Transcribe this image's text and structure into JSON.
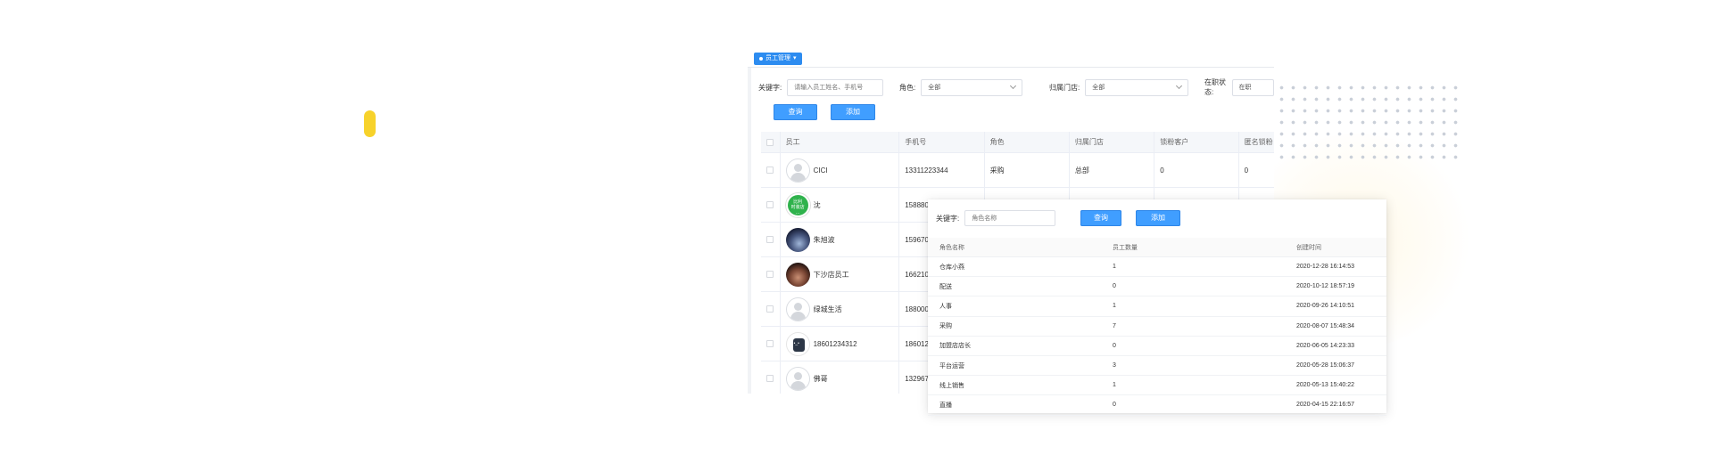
{
  "tabs": [
    {
      "label": "员工管理",
      "caret": "▾",
      "active": true
    }
  ],
  "filters": {
    "keyword_label": "关键字:",
    "keyword_placeholder": "请输入员工姓名、手机号",
    "role_label": "角色:",
    "role_value": "全部",
    "store_label": "归属门店:",
    "store_value": "全部",
    "status_label": "在职状态:",
    "status_value": "在职"
  },
  "buttons": {
    "search": "查询",
    "add": "添加"
  },
  "employee_table": {
    "columns": [
      "员工",
      "手机号",
      "角色",
      "归属门店",
      "锁粉客户",
      "匿名锁粉"
    ],
    "rows": [
      {
        "name": "CICI",
        "phone": "13311223344",
        "role": "采购",
        "store": "总部",
        "clients": "0",
        "anon": "0",
        "avatar": "default"
      },
      {
        "name": "沈",
        "phone": "1588803",
        "role": "",
        "store": "",
        "clients": "",
        "anon": "",
        "avatar": "green-badge",
        "avatar_text": [
          "比利",
          "时装店",
          "..."
        ]
      },
      {
        "name": "朱旭波",
        "phone": "159670",
        "role": "",
        "store": "",
        "clients": "",
        "anon": "",
        "avatar": "night-sky"
      },
      {
        "name": "下沙店员工",
        "phone": "166210",
        "role": "",
        "store": "",
        "clients": "",
        "anon": "",
        "avatar": "photo"
      },
      {
        "name": "绿城生活",
        "phone": "188000",
        "role": "",
        "store": "",
        "clients": "",
        "anon": "",
        "avatar": "default"
      },
      {
        "name": "18601234312",
        "phone": "186012",
        "role": "",
        "store": "",
        "clients": "",
        "anon": "",
        "avatar": "robot"
      },
      {
        "name": "佛哥",
        "phone": "132967",
        "role": "",
        "store": "",
        "clients": "",
        "anon": "",
        "avatar": "default"
      }
    ]
  },
  "role_panel": {
    "keyword_label": "关键字:",
    "keyword_placeholder": "角色名称",
    "search_label": "查询",
    "add_label": "添加",
    "columns": [
      "角色名称",
      "员工数量",
      "创建时间"
    ],
    "rows": [
      {
        "name": "仓库小燕",
        "count": "1",
        "created": "2020-12-28 16:14:53"
      },
      {
        "name": "配送",
        "count": "0",
        "created": "2020-10-12 18:57:19"
      },
      {
        "name": "人事",
        "count": "1",
        "created": "2020-09-26 14:10:51"
      },
      {
        "name": "采购",
        "count": "7",
        "created": "2020-08-07 15:48:34"
      },
      {
        "name": "加盟店店长",
        "count": "0",
        "created": "2020-06-05 14:23:33"
      },
      {
        "name": "平台运营",
        "count": "3",
        "created": "2020-05-28 15:06:37"
      },
      {
        "name": "线上销售",
        "count": "1",
        "created": "2020-05-13 15:40:22"
      },
      {
        "name": "直播",
        "count": "0",
        "created": "2020-04-15 22:16:57"
      }
    ]
  },
  "colors": {
    "primary": "#409eff",
    "tab": "#2d8cf0",
    "accent_yellow": "#f7d22b"
  }
}
